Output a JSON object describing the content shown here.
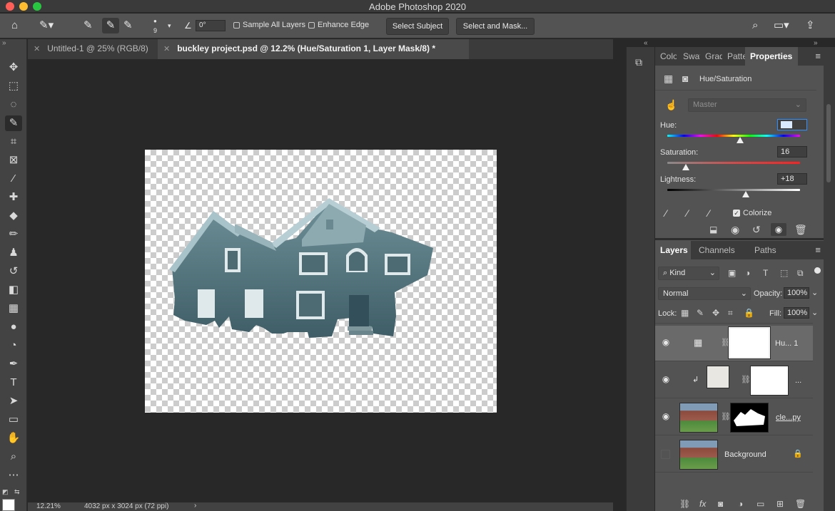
{
  "window": {
    "title": "Adobe Photoshop 2020",
    "traffic_colors": [
      "#ff5f57",
      "#febc2e",
      "#28c840"
    ]
  },
  "options_bar": {
    "brush_size": "9",
    "angle_value": "0°",
    "sample_all_layers_label": "Sample All Layers",
    "enhance_edge_label": "Enhance Edge",
    "select_subject_label": "Select Subject",
    "select_and_mask_label": "Select and Mask..."
  },
  "tabs": [
    {
      "label": "Untitled-1 @ 25% (RGB/8)",
      "active": false
    },
    {
      "label": "buckley project.psd @ 12.2% (Hue/Saturation 1, Layer Mask/8) *",
      "active": true
    }
  ],
  "tools": [
    "move-tool",
    "marquee-tool",
    "lasso-tool",
    "quick-selection-tool",
    "crop-tool",
    "frame-tool",
    "eyedropper-tool",
    "healing-brush-tool",
    "paint-bucket-tool",
    "brush-tool",
    "clone-stamp-tool",
    "history-brush-tool",
    "eraser-tool",
    "gradient-tool",
    "blur-tool",
    "dodge-tool",
    "pen-tool",
    "type-tool",
    "path-selection-tool",
    "rectangle-tool",
    "hand-tool",
    "zoom-tool",
    "more-tools"
  ],
  "status": {
    "zoom": "12.21%",
    "doc_size": "4032 px x 3024 px (72 ppi)"
  },
  "properties": {
    "tabs": [
      "Colo",
      "Swat",
      "Grad",
      "Patte",
      "Properties"
    ],
    "adjustment_name": "Hue/Saturation",
    "preset": "Master",
    "hue_label": "Hue:",
    "hue_value": "",
    "hue_level": 0.55,
    "saturation_label": "Saturation:",
    "saturation_value": "16",
    "saturation_level": 0.14,
    "lightness_label": "Lightness:",
    "lightness_value": "+18",
    "lightness_level": 0.59,
    "colorize_label": "Colorize",
    "colorize_checked": true
  },
  "layers_panel": {
    "tabs": [
      "Layers",
      "Channels",
      "Paths"
    ],
    "filter_kind": "Kind",
    "blend_mode": "Normal",
    "opacity_label": "Opacity:",
    "opacity_value": "100%",
    "lock_label": "Lock:",
    "fill_label": "Fill:",
    "fill_value": "100%",
    "layers": [
      {
        "name": "Hu... 1",
        "visible": true,
        "selected": true
      },
      {
        "name": "...",
        "visible": true,
        "selected": false
      },
      {
        "name": "cle...py",
        "visible": true,
        "selected": false
      },
      {
        "name": "Background",
        "visible": false,
        "selected": false
      }
    ]
  },
  "accent": "#2f8fff"
}
